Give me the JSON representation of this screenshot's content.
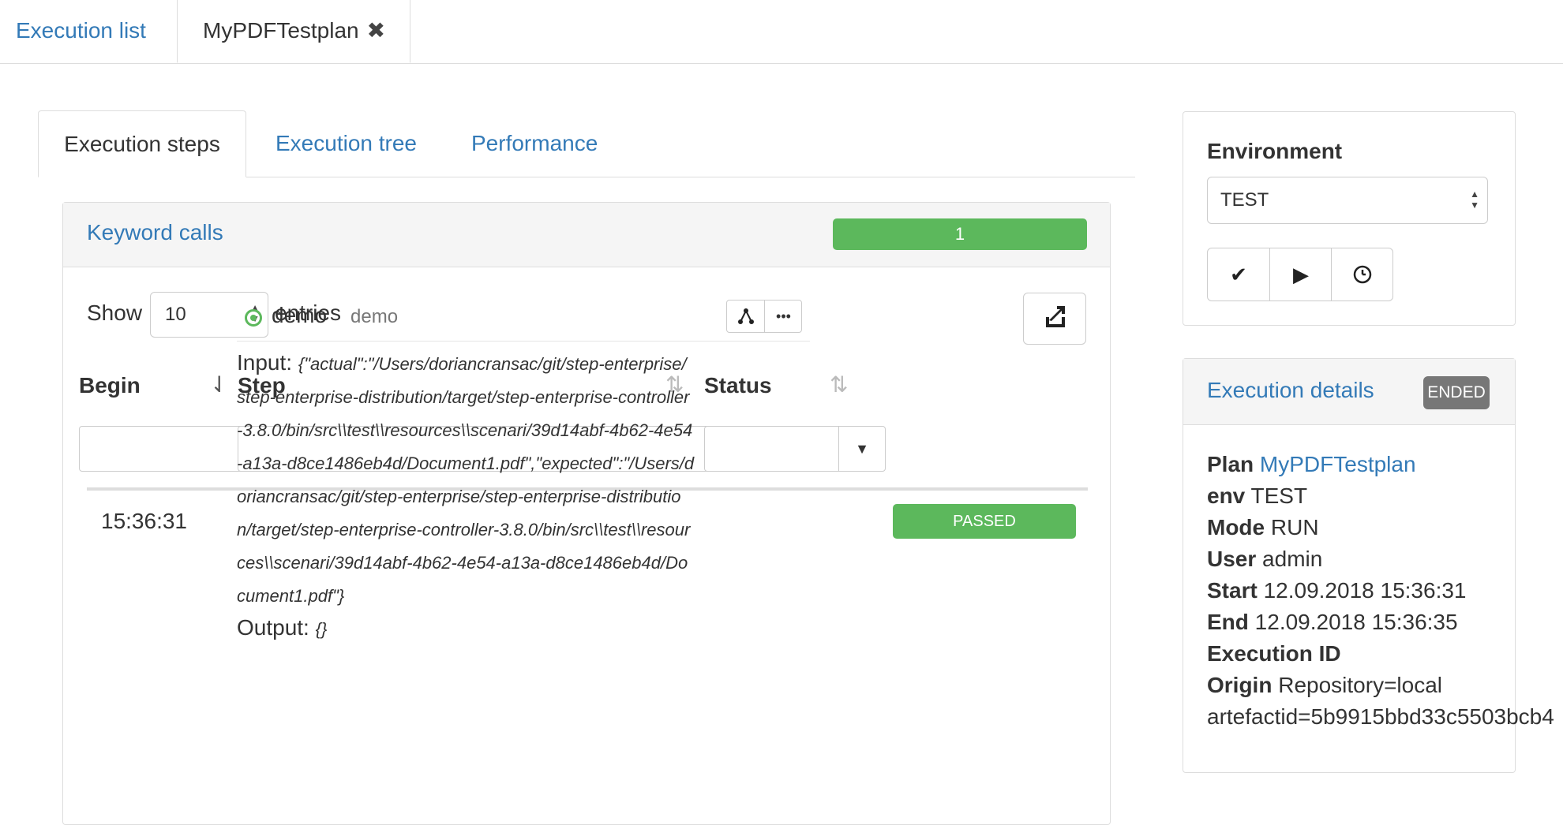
{
  "top_tabs": {
    "execution_list": "Execution list",
    "plan_tab": "MyPDFTestplan",
    "close_glyph": "✖"
  },
  "inner_tabs": {
    "steps": "Execution steps",
    "tree": "Execution tree",
    "performance": "Performance"
  },
  "keyword_panel": {
    "title": "Keyword calls",
    "progress_value": "1",
    "show_label": "Show",
    "page_size": "10",
    "entries_label": "entries",
    "columns": {
      "begin": "Begin",
      "step": "Step",
      "status": "Status"
    },
    "row": {
      "time": "15:36:31",
      "step_name": "demo",
      "step_sub": "demo",
      "status": "PASSED",
      "input_label": "Input:",
      "input_value": "{\"actual\":\"/Users/doriancransac/git/step-enterprise/step-enterprise-distribution/target/step-enterprise-controller-3.8.0/bin/src\\\\test\\\\resources\\\\scenari/39d14abf-4b62-4e54-a13a-d8ce1486eb4d/Document1.pdf\",\"expected\":\"/Users/doriancransac/git/step-enterprise/step-enterprise-distribution/target/step-enterprise-controller-3.8.0/bin/src\\\\test\\\\resources\\\\scenari/39d14abf-4b62-4e54-a13a-d8ce1486eb4d/Document1.pdf\"}",
      "output_label": "Output:",
      "output_value": "{}"
    }
  },
  "environment": {
    "title": "Environment",
    "selected": "TEST"
  },
  "details": {
    "title": "Execution details",
    "badge": "ENDED",
    "plan_label": "Plan",
    "plan_value": "MyPDFTestplan",
    "env_label": "env",
    "env_value": "TEST",
    "mode_label": "Mode",
    "mode_value": "RUN",
    "user_label": "User",
    "user_value": "admin",
    "start_label": "Start",
    "start_value": "12.09.2018 15:36:31",
    "end_label": "End",
    "end_value": "12.09.2018 15:36:35",
    "exec_id_label": "Execution ID",
    "origin_label": "Origin",
    "origin_value": "Repository=local",
    "origin_value2": "artefactid=5b9915bbd33c5503bcb4"
  },
  "colors": {
    "link": "#337ab7",
    "success": "#5cb85c",
    "badge_gray": "#777777"
  },
  "icons": [
    "close-icon",
    "export-icon",
    "sort-desc-icon",
    "sort-icon",
    "caret-down-icon",
    "status-circle-icon",
    "tree-icon",
    "more-icon",
    "check-icon",
    "play-icon",
    "clock-icon"
  ]
}
